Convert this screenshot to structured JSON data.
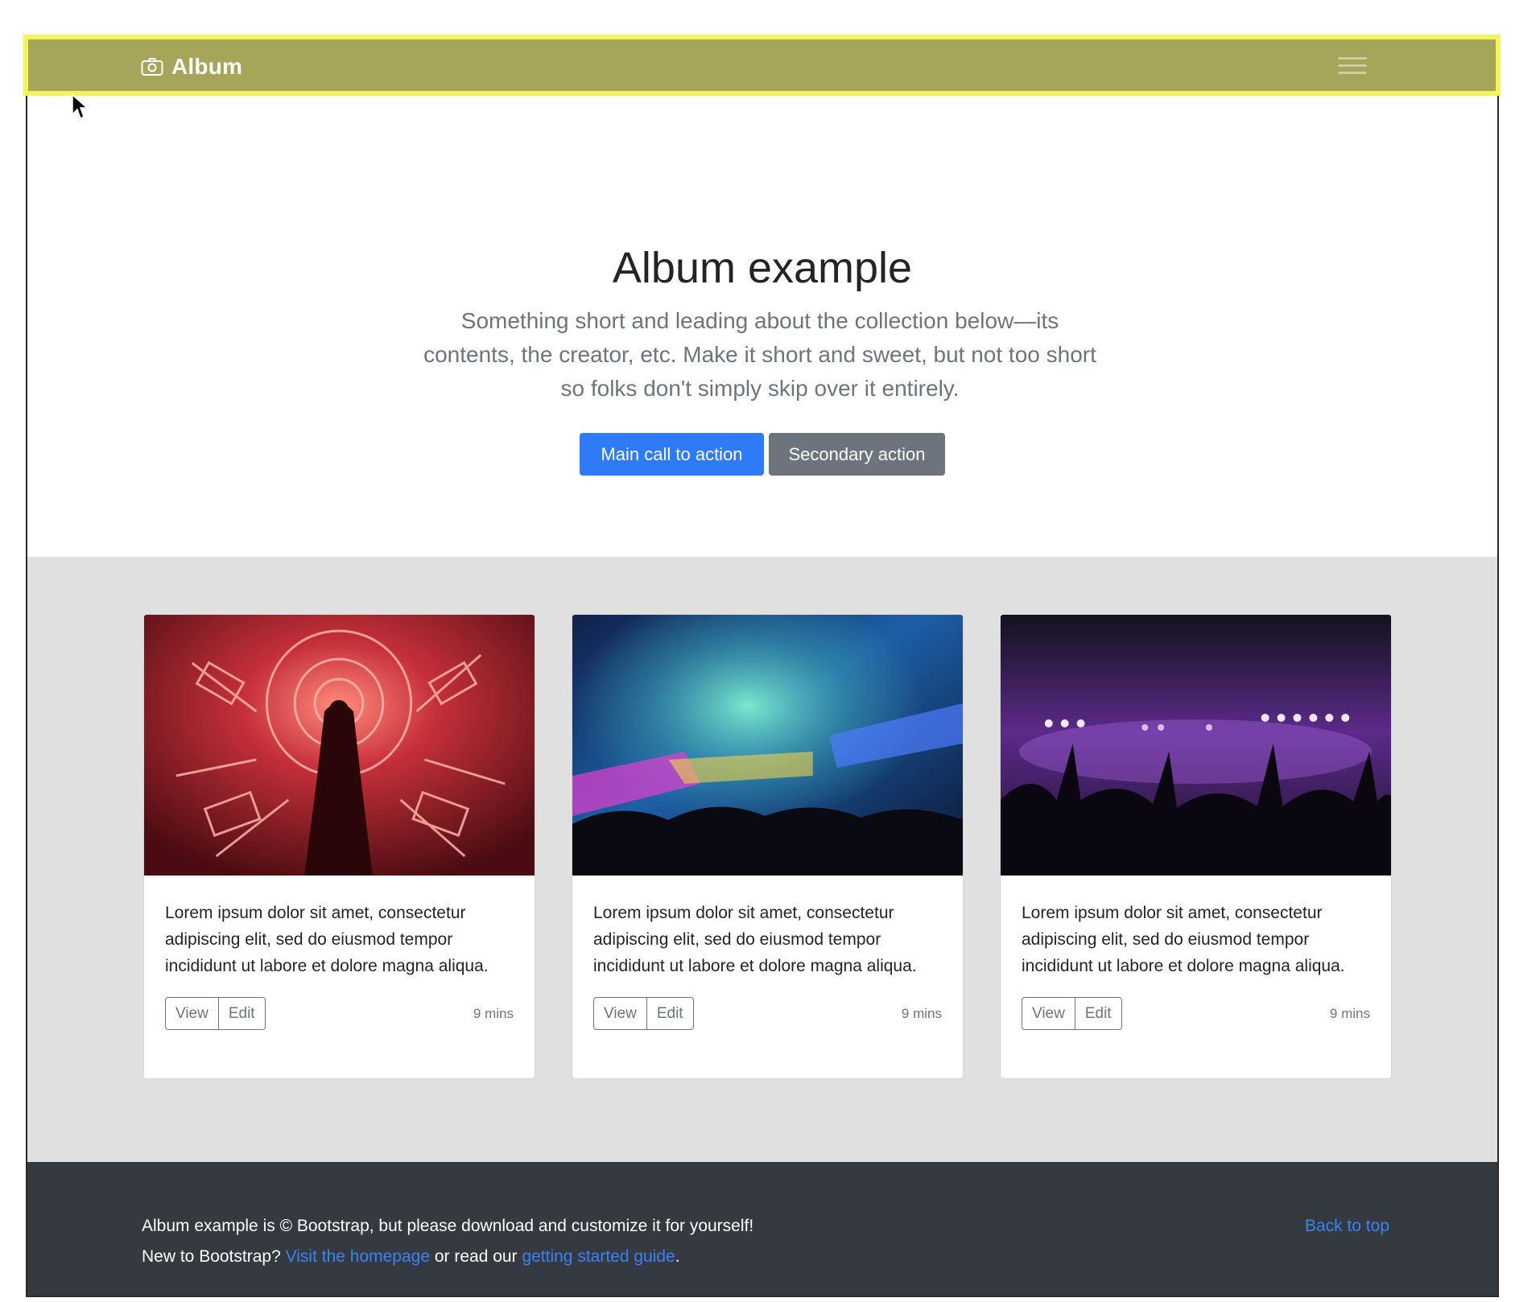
{
  "navbar": {
    "brand": "Album",
    "brand_icon": "camera-icon",
    "toggler_icon": "hamburger-menu-icon",
    "bg_color": "#a6a55a",
    "highlight_border_color": "#f4f45a"
  },
  "hero": {
    "title": "Album example",
    "lead": "Something short and leading about the collection below—its contents, the creator, etc. Make it short and sweet, but not too short so folks don't simply skip over it entirely.",
    "primary_button": "Main call to action",
    "secondary_button": "Secondary action"
  },
  "cards": [
    {
      "image": "neon-orchestra-photo",
      "text": "Lorem ipsum dolor sit amet, consectetur adipiscing elit, sed do eiusmod tempor incididunt ut labore et dolore magna aliqua.",
      "view": "View",
      "edit": "Edit",
      "duration": "9 mins"
    },
    {
      "image": "concert-lights-crowd-photo",
      "text": "Lorem ipsum dolor sit amet, consectetur adipiscing elit, sed do eiusmod tempor incididunt ut labore et dolore magna aliqua.",
      "view": "View",
      "edit": "Edit",
      "duration": "9 mins"
    },
    {
      "image": "concert-purple-stage-photo",
      "text": "Lorem ipsum dolor sit amet, consectetur adipiscing elit, sed do eiusmod tempor incididunt ut labore et dolore magna aliqua.",
      "view": "View",
      "edit": "Edit",
      "duration": "9 mins"
    }
  ],
  "footer": {
    "line1": "Album example is © Bootstrap, but please download and customize it for yourself!",
    "line2_prefix": "New to Bootstrap?",
    "homepage_link": "Visit the homepage",
    "line2_middle": "or read our",
    "guide_link": "getting started guide",
    "line2_suffix": ".",
    "back_to_top": "Back to top"
  },
  "colors": {
    "primary": "#2f7af7",
    "secondary": "#6c757d",
    "album_bg": "#e0e0e0",
    "footer_bg": "#343a40",
    "link": "#3b82f6"
  }
}
